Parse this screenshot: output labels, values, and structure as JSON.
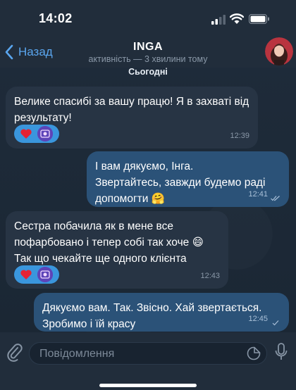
{
  "status_bar": {
    "time": "14:02"
  },
  "header": {
    "back_label": "Назад",
    "title": "INGA",
    "subtitle": "активність — 3 хвилини тому"
  },
  "date_separator": "Сьогодні",
  "messages": [
    {
      "direction": "incoming",
      "text": "Велике спасибі за вашу працю! Я в захваті від результату!",
      "time": "12:39",
      "reactions": [
        "red-heart",
        "user-avatar"
      ]
    },
    {
      "direction": "outgoing",
      "text": "І вам дякуємо, Інга.\nЗвертайтесь, завжди будемо раді допомогти 🤗",
      "time": "12:41",
      "read": true
    },
    {
      "direction": "incoming",
      "text": "Сестра побачила як в мене все пофарбовано і тепер собі так хоче 😄\nТак що чекайте ще одного клієнта",
      "time": "12:43",
      "reactions": [
        "red-heart",
        "user-avatar"
      ]
    },
    {
      "direction": "outgoing",
      "text": "Дякуємо вам. Так. Звісно. Хай звертається.\nЗробимо і їй красу",
      "time": "12:45",
      "read": false
    }
  ],
  "composer": {
    "placeholder": "Повідомлення"
  },
  "colors": {
    "accent": "#5aa6ef",
    "incoming_bubble": "#273444",
    "outgoing_bubble": "#2b5278",
    "reaction": "#3a96dd"
  }
}
